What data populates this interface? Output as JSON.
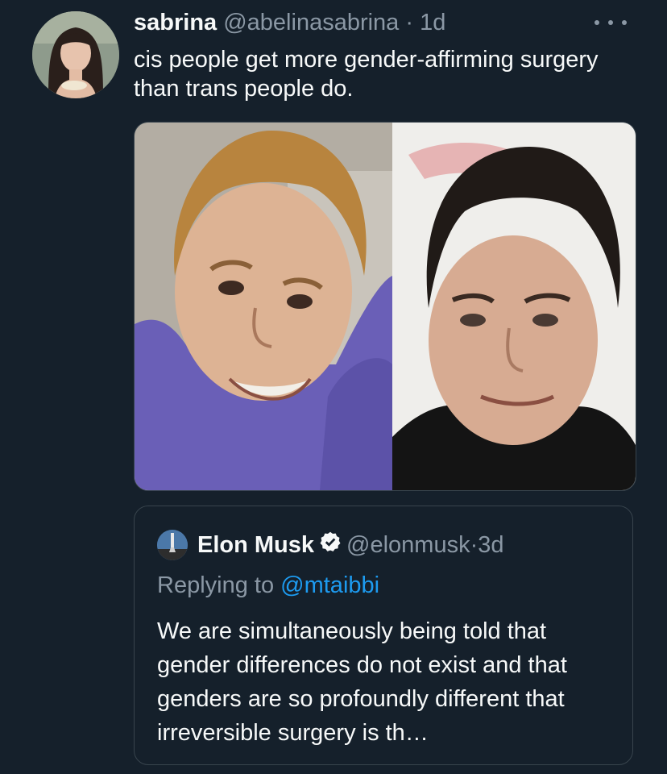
{
  "tweet": {
    "author_name": "sabrina",
    "author_handle": "@abelinasabrina",
    "separator": "·",
    "time": "1d",
    "text": "cis people get more gender-affirming surgery than trans people do.",
    "more_icon": "more-horizontal-icon"
  },
  "quote": {
    "author_name": "Elon Musk",
    "verified_icon": "verified-badge-icon",
    "author_handle": "@elonmusk",
    "separator": "·",
    "time": "3d",
    "replying_prefix": "Replying to",
    "replying_to": "@mtaibbi",
    "text": "We are simultaneously being told that gender differences do not exist and that genders are so profoundly different that irreversible surgery is th…"
  },
  "colors": {
    "background": "#15202b",
    "text_primary": "#f7f9f9",
    "text_secondary": "#8b98a5",
    "link": "#1d9bf0",
    "border": "#38444d",
    "verified": "#1d9bf0"
  }
}
